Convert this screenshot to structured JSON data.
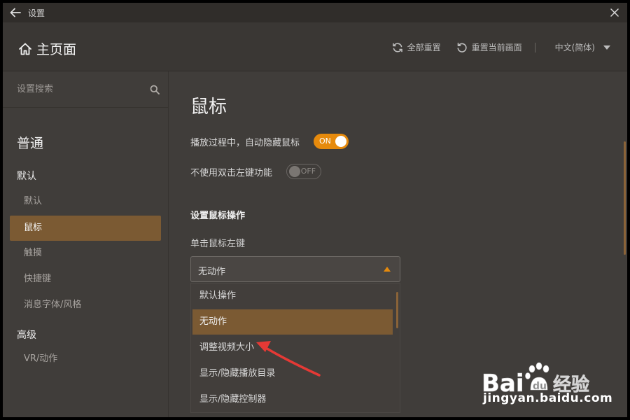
{
  "window": {
    "title": "设置"
  },
  "header": {
    "home_title": "主页面",
    "reset_all": "全部重置",
    "reset_current": "重置当前画面",
    "language": "中文(简体)"
  },
  "sidebar": {
    "search_placeholder": "设置搜索",
    "section_general": "普通",
    "group_default": "默认",
    "items": [
      {
        "label": "默认"
      },
      {
        "label": "鼠标",
        "active": true
      },
      {
        "label": "触摸"
      },
      {
        "label": "快捷键"
      },
      {
        "label": "消息字体/风格"
      }
    ],
    "section_advanced": "高级",
    "advanced_items": [
      {
        "label": "VR/动作"
      }
    ]
  },
  "main": {
    "title": "鼠标",
    "auto_hide": {
      "label": "播放过程中，自动隐藏鼠标",
      "state": "ON"
    },
    "no_dblclick": {
      "label": "不使用双击左键功能",
      "state": "OFF"
    },
    "section_mouse_op": "设置鼠标操作",
    "left_click_label": "单击鼠标左键",
    "left_click_value": "无动作",
    "dropdown_options": [
      {
        "label": "默认操作"
      },
      {
        "label": "无动作",
        "selected": true
      },
      {
        "label": "调整视频大小"
      },
      {
        "label": "显示/隐藏播放目录"
      },
      {
        "label": "显示/隐藏控制器"
      }
    ]
  },
  "colors": {
    "accent": "#e68a0c",
    "selection": "#7b5a33",
    "annotation_arrow": "#e53935"
  },
  "icons": [
    "back-arrow-icon",
    "close-icon",
    "home-icon",
    "refresh-all-icon",
    "refresh-current-icon",
    "chevron-down-icon",
    "search-icon",
    "caret-up-icon"
  ],
  "watermark": {
    "logo_text": "Bai du 经验",
    "url": "jingyan.baidu.com"
  }
}
